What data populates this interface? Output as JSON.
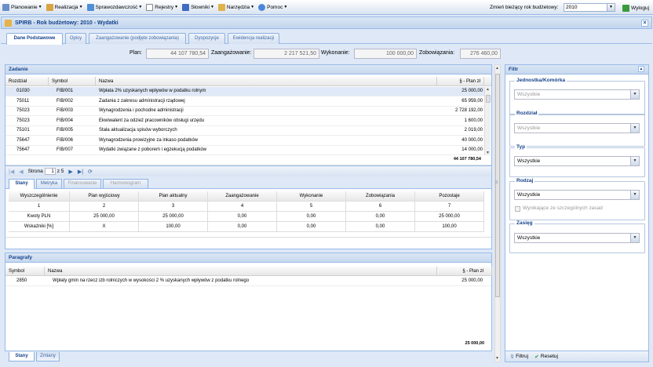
{
  "menu": {
    "items": [
      {
        "label": "Planowanie",
        "icon": "planning-icon"
      },
      {
        "label": "Realizacja",
        "icon": "realization-icon"
      },
      {
        "label": "Sprawozdawczość",
        "icon": "reports-icon"
      },
      {
        "label": "Rejestry",
        "icon": "registry-icon"
      },
      {
        "label": "Słowniki",
        "icon": "dictionary-icon"
      },
      {
        "label": "Narzędzia",
        "icon": "tools-icon"
      },
      {
        "label": "Pomoc",
        "icon": "help-icon"
      }
    ],
    "year_label": "Zmień bieżący rok budżetowy:",
    "year_value": "2010",
    "logout_label": "Wyloguj"
  },
  "window": {
    "title": "SPIRB - Rok budżetowy: 2010 - Wydatki"
  },
  "tabs": [
    "Dane Podstawowe",
    "Opisy",
    "Zaangażowanie (podjęte zobowiązania)",
    "Dyspozycje",
    "Ewidencja realizacji"
  ],
  "summary": {
    "plan_label": "Plan:",
    "plan_value": "44 107 780,54",
    "zaang_label": "Zaangażowanie:",
    "zaang_value": "2 217 521,50",
    "wyk_label": "Wykonanie:",
    "wyk_value": "100 000,00",
    "zob_label": "Zobowiązania:",
    "zob_value": "276 460,00"
  },
  "zadanie": {
    "title": "Zadanie",
    "columns": [
      "Rozdział",
      "Symbol",
      "Nazwa",
      "§ - Plan zł"
    ],
    "rows": [
      [
        "01030",
        "FIB/001",
        "Wpłata 2% uzyskanych wpływów w podatku rolnym",
        "25 000,00"
      ],
      [
        "75011",
        "FIB/002",
        "Zadania z zakresu administracji rządowej",
        "65 959,00"
      ],
      [
        "75023",
        "FIB/003",
        "Wynagrodzenia i pochodne administracji",
        "2 728 192,00"
      ],
      [
        "75023",
        "FIB/004",
        "Ekwiwalent za odzież pracowników obsługi urzędu",
        "1 600,00"
      ],
      [
        "75101",
        "FIB/005",
        "Stała aktualizacja spisów wyborczych",
        "2 019,00"
      ],
      [
        "75647",
        "FIB/006",
        "Wynagrodzenia prowizyjne za inkaso podatków",
        "40 000,00"
      ],
      [
        "75647",
        "FIB/007",
        "Wydatki związane z poborem i egzekucją podatków",
        "14 000,00"
      ]
    ],
    "total": "44 107 780,54",
    "paging": {
      "label": "Strona",
      "page": "1",
      "of": "z 5"
    }
  },
  "subtabs": [
    "Stany",
    "Metryka",
    "Finansowanie",
    "Harmonogram"
  ],
  "stany": {
    "headers": [
      "Wyszczególnienie",
      "Plan wyjściowy",
      "Plan aktualny",
      "Zaangażowanie",
      "Wykonanie",
      "Zobowiązania",
      "Pozostaje"
    ],
    "numbers": [
      "1",
      "2",
      "3",
      "4",
      "5",
      "6",
      "7"
    ],
    "rows": [
      [
        "Kwoty PLN",
        "25 000,00",
        "25 000,00",
        "0,00",
        "0,00",
        "0,00",
        "25 000,00"
      ],
      [
        "Wskaźniki [%]",
        "X",
        "100,00",
        "0,00",
        "0,00",
        "0,00",
        "100,00"
      ]
    ]
  },
  "paragrafy": {
    "title": "Paragrafy",
    "columns": [
      "Symbol",
      "Nazwa",
      "§ - Plan zł"
    ],
    "rows": [
      [
        "2850",
        "Wpłaty gmin na rzecz izb rolniczych w wysokości 2 % uzyskanych wpływów z podatku rolnego",
        "25 000,00"
      ]
    ],
    "total": "25 000,00"
  },
  "bottom_tabs": [
    "Stany",
    "Zmiany"
  ],
  "filter": {
    "title": "Filtr",
    "groups": [
      {
        "label": "Jednostka/Komórka",
        "value": "Wszystkie"
      },
      {
        "label": "Rozdział",
        "value": "Wszystkie"
      },
      {
        "label": "Typ",
        "value": "Wszystkie"
      },
      {
        "label": "Rodzaj",
        "value": "Wszystkie"
      },
      {
        "label": "Zasięg",
        "value": "Wszystkie"
      }
    ],
    "checkbox_label": "Wynikające ze szczególnych zasad",
    "apply_label": "Filtruj",
    "reset_label": "Resetuj"
  },
  "colors": {
    "accent": "#15428b",
    "border": "#99bbe8",
    "bg": "#dfe8f6"
  }
}
